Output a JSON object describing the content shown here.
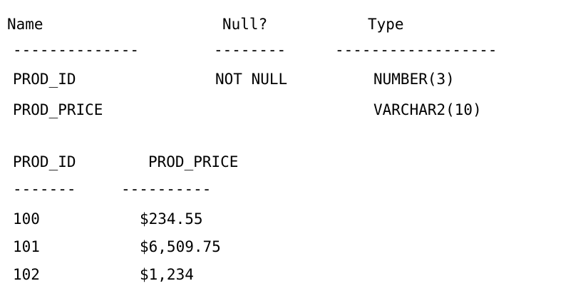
{
  "describe": {
    "headers": {
      "name": "Name",
      "null": "Null?",
      "type": "Type"
    },
    "separator": {
      "name": "--------------",
      "null": "--------",
      "type": "------------------"
    },
    "rows": [
      {
        "name": "PROD_ID",
        "null": "NOT NULL",
        "type": "NUMBER(3)"
      },
      {
        "name": "PROD_PRICE",
        "null": "",
        "type": "VARCHAR2(10)"
      }
    ]
  },
  "query": {
    "headers": {
      "prod_id": "PROD_ID",
      "prod_price": "PROD_PRICE"
    },
    "separator": {
      "prod_id": "-------",
      "prod_price": "----------"
    },
    "rows": [
      {
        "prod_id": "100",
        "prod_price": "$234.55"
      },
      {
        "prod_id": "101",
        "prod_price": "$6,509.75"
      },
      {
        "prod_id": "102",
        "prod_price": "$1,234"
      }
    ]
  }
}
